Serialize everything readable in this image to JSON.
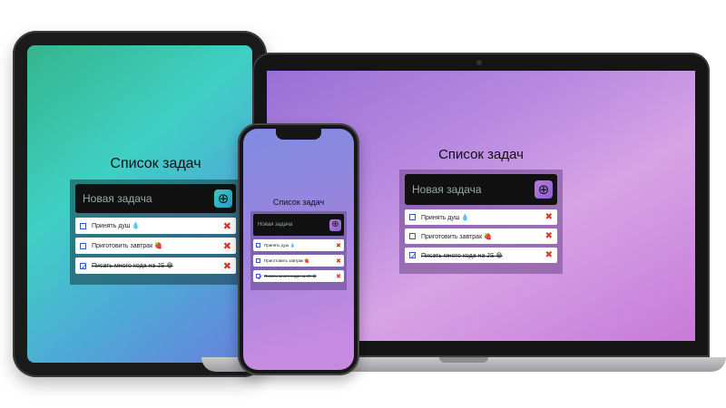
{
  "app": {
    "title": "Список задач",
    "input_placeholder": "Новая задача",
    "add_icon": "⊕",
    "check_mark": "✓",
    "delete_icon": "✖",
    "tasks": [
      {
        "text": "Принять душ 💧",
        "done": false
      },
      {
        "text": "Приготовить завтрак 🍓",
        "done": false
      },
      {
        "text": "Писать много кода на JS 😁",
        "done": true
      }
    ]
  },
  "colors": {
    "tablet_gradient": [
      "#35b58c",
      "#3fd0c4",
      "#6a7fdb"
    ],
    "laptop_gradient": [
      "#9a6fd6",
      "#d7a3e6",
      "#c77ad8"
    ],
    "delete": "#d43a2e",
    "checkbox": "#3557c9"
  }
}
